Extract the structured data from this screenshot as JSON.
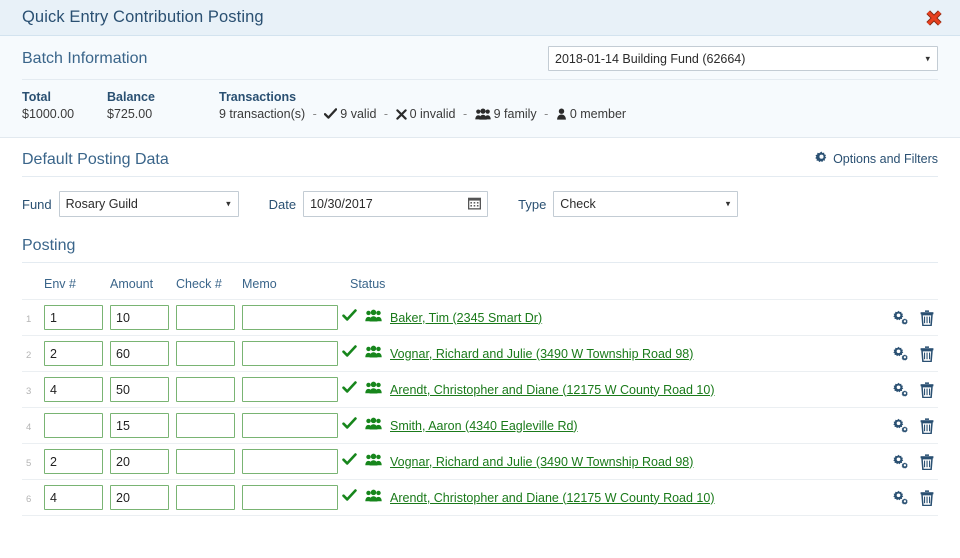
{
  "window": {
    "title": "Quick Entry Contribution Posting",
    "close_icon": "close-x-icon"
  },
  "batch_information": {
    "heading": "Batch Information",
    "batch_select": {
      "value": "2018-01-14 Building Fund (62664)",
      "caret": "▾"
    },
    "columns": {
      "total_label": "Total",
      "balance_label": "Balance",
      "transactions_label": "Transactions"
    },
    "values": {
      "total": "$1000.00",
      "balance": "$725.00",
      "transactions_count": "9 transaction(s)",
      "valid": "9 valid",
      "invalid": "0 invalid",
      "family": "9 family",
      "member": "0 member",
      "separator": "-"
    }
  },
  "default_posting_data": {
    "heading": "Default Posting Data",
    "options_link": "Options and Filters",
    "fund": {
      "label": "Fund",
      "value": "Rosary Guild"
    },
    "date": {
      "label": "Date",
      "value": "10/30/2017"
    },
    "type": {
      "label": "Type",
      "value": "Check"
    },
    "caret": "▾"
  },
  "posting": {
    "heading": "Posting",
    "columns": {
      "env": "Env #",
      "amount": "Amount",
      "check": "Check #",
      "memo": "Memo",
      "status": "Status"
    },
    "rows": [
      {
        "index": "1",
        "env": "1",
        "amount": "10",
        "check": "",
        "memo": "",
        "status_icon": "check-icon",
        "type_icon": "family-icon",
        "person": "Baker, Tim (2345 Smart Dr)"
      },
      {
        "index": "2",
        "env": "2",
        "amount": "60",
        "check": "",
        "memo": "",
        "status_icon": "check-icon",
        "type_icon": "family-icon",
        "person": "Vognar, Richard and Julie (3490 W Township Road 98)"
      },
      {
        "index": "3",
        "env": "4",
        "amount": "50",
        "check": "",
        "memo": "",
        "status_icon": "check-icon",
        "type_icon": "family-icon",
        "person": "Arendt, Christopher and Diane (12175 W County Road 10)"
      },
      {
        "index": "4",
        "env": "",
        "amount": "15",
        "check": "",
        "memo": "",
        "status_icon": "check-icon",
        "type_icon": "family-icon",
        "person": "Smith, Aaron (4340 Eagleville Rd)"
      },
      {
        "index": "5",
        "env": "2",
        "amount": "20",
        "check": "",
        "memo": "",
        "status_icon": "check-icon",
        "type_icon": "family-icon",
        "person": "Vognar, Richard and Julie (3490 W Township Road 98)"
      },
      {
        "index": "6",
        "env": "4",
        "amount": "20",
        "check": "",
        "memo": "",
        "status_icon": "check-icon",
        "type_icon": "family-icon",
        "person": "Arendt, Christopher and Diane (12175 W County Road 10)"
      }
    ],
    "row_actions": {
      "settings_icon": "cogs-icon",
      "delete_icon": "trash-icon"
    }
  },
  "colors": {
    "title_bar_bg": "#e8f1f8",
    "panel_bg": "#f6fafd",
    "heading_text": "#3a658a",
    "link_green": "#1a7a1a",
    "input_border_green": "#79b473",
    "icon_blue": "#2a5072",
    "close_red": "#e8401f"
  }
}
